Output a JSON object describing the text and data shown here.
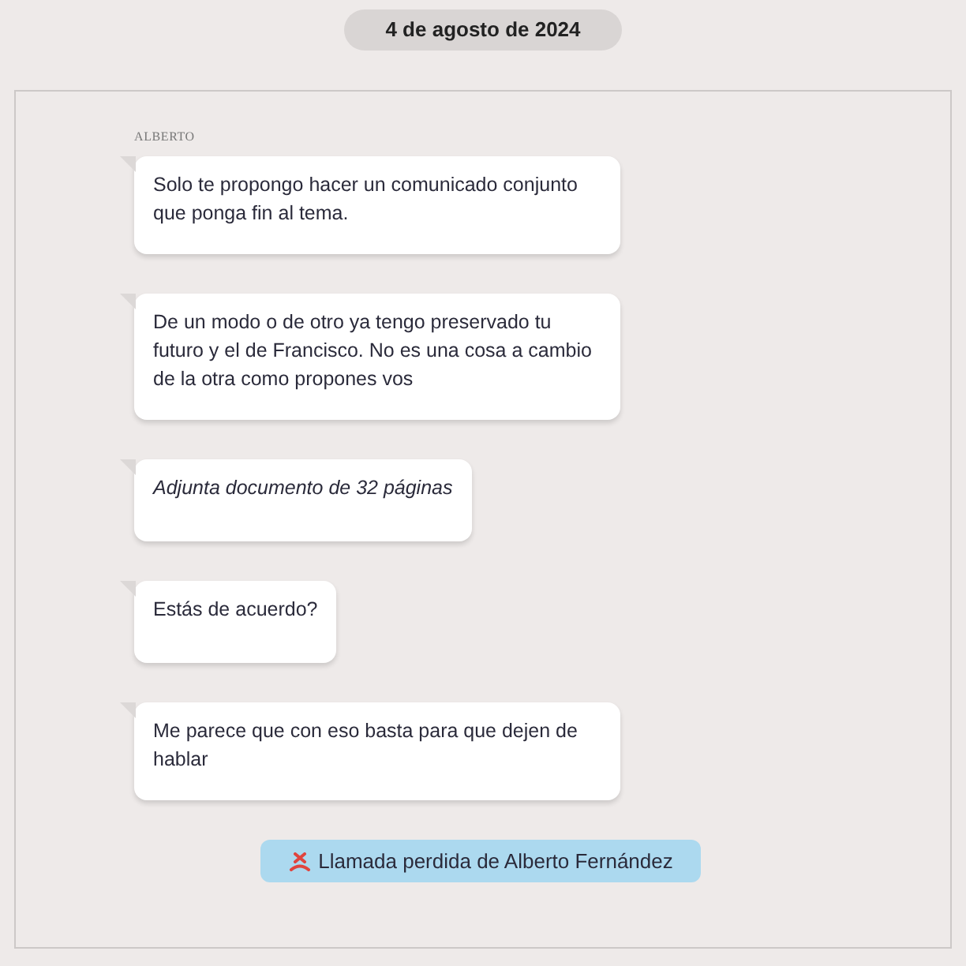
{
  "date_pill": "4 de agosto de 2024",
  "sender": "ALBERTO",
  "messages": [
    {
      "kind": "text",
      "text": "Solo te propongo hacer un comunicado conjunto que ponga fin al tema."
    },
    {
      "kind": "text",
      "text": "De un modo o de otro ya tengo preservado tu futuro y el de Francisco. No es una cosa a cambio de la otra como propones vos"
    },
    {
      "kind": "attachment",
      "text": "Adjunta documento de 32 páginas"
    },
    {
      "kind": "text",
      "text": "Estás de acuerdo?"
    },
    {
      "kind": "text",
      "text": "Me parece que con eso basta para que dejen de hablar"
    }
  ],
  "missed_call": {
    "text": "Llamada perdida de Alberto Fernández"
  }
}
